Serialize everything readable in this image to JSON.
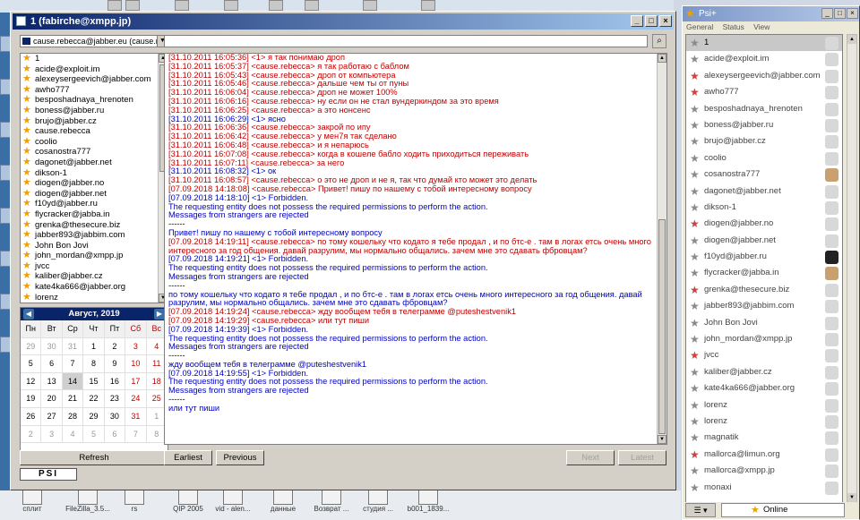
{
  "desktop": {
    "bottom_icons": [
      {
        "label": "сплит",
        "icon": "folder-icon"
      },
      {
        "label": "FileZilla_3.5...",
        "icon": "filezilla-icon"
      },
      {
        "label": "rs",
        "icon": "archive-icon"
      },
      {
        "label": "QIP 2005",
        "icon": "qip-icon"
      },
      {
        "label": "vid - alen...",
        "icon": "document-icon"
      },
      {
        "label": "данные",
        "icon": "document-icon"
      },
      {
        "label": "Возврат ...",
        "icon": "document-icon"
      },
      {
        "label": "студия ...",
        "icon": "document-icon"
      },
      {
        "label": "b001_1839...",
        "icon": "pdf-icon"
      }
    ]
  },
  "chat": {
    "title": "1 (fabirche@xmpp.jp)",
    "account": "cause.rebecca@jabber.eu (cause.reb",
    "contacts": [
      "1",
      "acide@exploit.im",
      "alexeysergeevich@jabber.com",
      "awho777",
      "besposhadnaya_hrenoten",
      "boness@jabber.ru",
      "brujo@jabber.cz",
      "cause.rebecca",
      "coolio",
      "cosanostra777",
      "dagonet@jabber.net",
      "dikson-1",
      "diogen@jabber.no",
      "diogen@jabber.net",
      "f10yd@jabber.ru",
      "flycracker@jabba.in",
      "grenka@thesecure.biz",
      "jabber893@jabbim.com",
      "John Bon Jovi",
      "john_mordan@xmpp.jp",
      "jvcc",
      "kaliber@jabber.cz",
      "kate4ka666@jabber.org",
      "lorenz"
    ],
    "calendar": {
      "month_label": "Август, 2019",
      "weekdays": [
        "Пн",
        "Вт",
        "Ср",
        "Чт",
        "Пт",
        "Сб",
        "Вс"
      ],
      "weeks": [
        [
          "29",
          "30",
          "31",
          "1",
          "2",
          "3",
          "4"
        ],
        [
          "5",
          "6",
          "7",
          "8",
          "9",
          "10",
          "11"
        ],
        [
          "12",
          "13",
          "14",
          "15",
          "16",
          "17",
          "18"
        ],
        [
          "19",
          "20",
          "21",
          "22",
          "23",
          "24",
          "25"
        ],
        [
          "26",
          "27",
          "28",
          "29",
          "30",
          "31",
          "1"
        ],
        [
          "2",
          "3",
          "4",
          "5",
          "6",
          "7",
          "8"
        ]
      ],
      "today": "14"
    },
    "buttons": {
      "refresh": "Refresh",
      "earliest": "Earliest",
      "previous": "Previous",
      "next": "Next",
      "latest": "Latest"
    },
    "logo": "PSI",
    "log": [
      {
        "c": "rd",
        "t": "[31.10.2011 16:05:36] <1> я так понимаю дроп"
      },
      {
        "c": "rd",
        "t": "[31.10.2011 16:05:37] <cause.rebecca> я так работаю с баблом"
      },
      {
        "c": "rd",
        "t": "[31.10.2011 16:05:43] <cause.rebecca> дроп от компьютера"
      },
      {
        "c": "rd",
        "t": "[31.10.2011 16:05:46] <cause.rebecca> дальше чем ты от пуны"
      },
      {
        "c": "rd",
        "t": "[31.10.2011 16:06:04] <cause.rebecca> дроп не может 100%"
      },
      {
        "c": "rd",
        "t": "[31.10.2011 16:06:16] <cause.rebecca> ну если он не стал вундеркиндом за это время"
      },
      {
        "c": "rd",
        "t": "[31.10.2011 16:06:25] <cause.rebecca> а это нонсенс"
      },
      {
        "c": "bl",
        "t": "[31.10.2011 16:06:29] <1> ясно"
      },
      {
        "c": "rd",
        "t": "[31.10.2011 16:06:36] <cause.rebecca> закрой по ипу"
      },
      {
        "c": "rd",
        "t": "[31.10.2011 16:06:42] <cause.rebecca> у мен7я так сделано"
      },
      {
        "c": "rd",
        "t": "[31.10.2011 16:06:48] <cause.rebecca> и я непарюсь"
      },
      {
        "c": "rd",
        "t": "[31.10.2011 16:07:08] <cause.rebecca> когда в кошеле бабло ходить приходиться переживать"
      },
      {
        "c": "rd",
        "t": "[31.10.2011 16:07:11] <cause.rebecca> за него"
      },
      {
        "c": "bl",
        "t": "[31.10.2011 16:08:32] <1> ок"
      },
      {
        "c": "rd",
        "t": "[31.10.2011 16:08:57] <cause.rebecca> о это не дроп и не я, так что думай кто может это делать"
      },
      {
        "c": "rd",
        "t": "[07.09.2018 14:18:08] <cause.rebecca> Привет! пишу по нашему с тобой интересному вопросу"
      },
      {
        "c": "bl",
        "t": "[07.09.2018 14:18:10] <1> Forbidden."
      },
      {
        "c": "bl",
        "t": "The requesting entity does not possess the required permissions to perform the action."
      },
      {
        "c": "bl",
        "t": "Messages from strangers are rejected"
      },
      {
        "c": "bk",
        "t": "------"
      },
      {
        "c": "bl",
        "t": "Привет! пишу по нашему с тобой интересному вопросу"
      },
      {
        "c": "rd",
        "t": "[07.09.2018 14:19:11] <cause.rebecca> по тому кошельку что кодато я тебе продал , и по бтс-е . там в логах етсь очень много интересного за год общения. давай разрулим, мы нормально общались. зачем мне это сдавать фбровцам?",
        "w": true
      },
      {
        "c": "bl",
        "t": "[07.09.2018 14:19:21] <1> Forbidden."
      },
      {
        "c": "bl",
        "t": "The requesting entity does not possess the required permissions to perform the action."
      },
      {
        "c": "bl",
        "t": "Messages from strangers are rejected"
      },
      {
        "c": "bk",
        "t": "------"
      },
      {
        "c": "bl",
        "t": "по тому кошельку что кодато я тебе продал , и по бтс-е . там в логах етсь очень много интересного за год общения. давай разрулим, мы нормально общались. зачем мне это сдавать фбровцам?",
        "w": true
      },
      {
        "c": "rd",
        "t": "[07.09.2018 14:19:24] <cause.rebecca> жду вообщем тебя в телеграмме @puteshestvenik1"
      },
      {
        "c": "rd",
        "t": "[07.09.2018 14:19:29] <cause.rebecca> или тут пиши"
      },
      {
        "c": "bl",
        "t": "[07.09.2018 14:19:39] <1> Forbidden."
      },
      {
        "c": "bl",
        "t": "The requesting entity does not possess the required permissions to perform the action."
      },
      {
        "c": "bl",
        "t": "Messages from strangers are rejected"
      },
      {
        "c": "bk",
        "t": "------"
      },
      {
        "c": "bl",
        "t": "жду вообщем тебя в телеграмме @puteshestvenik1"
      },
      {
        "c": "bl",
        "t": "[07.09.2018 14:19:55] <1> Forbidden."
      },
      {
        "c": "bl",
        "t": "The requesting entity does not possess the required permissions to perform the action."
      },
      {
        "c": "bl",
        "t": "Messages from strangers are rejected"
      },
      {
        "c": "bk",
        "t": "------"
      },
      {
        "c": "bl",
        "t": "или тут пиши"
      }
    ]
  },
  "roster": {
    "title": "Psi+",
    "menu": [
      "General",
      "Status",
      "View"
    ],
    "contacts": [
      {
        "name": "1",
        "st": "gray",
        "av": "",
        "sel": true
      },
      {
        "name": "acide@exploit.im",
        "st": "gray",
        "av": ""
      },
      {
        "name": "alexeysergeevich@jabber.com",
        "st": "red",
        "av": ""
      },
      {
        "name": "awho777",
        "st": "red",
        "av": ""
      },
      {
        "name": "besposhadnaya_hrenoten",
        "st": "gray",
        "av": ""
      },
      {
        "name": "boness@jabber.ru",
        "st": "gray",
        "av": ""
      },
      {
        "name": "brujo@jabber.cz",
        "st": "gray",
        "av": ""
      },
      {
        "name": "coolio",
        "st": "gray",
        "av": ""
      },
      {
        "name": "cosanostra777",
        "st": "gray",
        "av": "tn"
      },
      {
        "name": "dagonet@jabber.net",
        "st": "gray",
        "av": ""
      },
      {
        "name": "dikson-1",
        "st": "gray",
        "av": ""
      },
      {
        "name": "diogen@jabber.no",
        "st": "red",
        "av": ""
      },
      {
        "name": "diogen@jabber.net",
        "st": "gray",
        "av": ""
      },
      {
        "name": "f10yd@jabber.ru",
        "st": "gray",
        "av": "dk"
      },
      {
        "name": "flycracker@jabba.in",
        "st": "gray",
        "av": "tn"
      },
      {
        "name": "grenka@thesecure.biz",
        "st": "red",
        "av": ""
      },
      {
        "name": "jabber893@jabbim.com",
        "st": "gray",
        "av": ""
      },
      {
        "name": "John Bon Jovi",
        "st": "gray",
        "av": ""
      },
      {
        "name": "john_mordan@xmpp.jp",
        "st": "gray",
        "av": ""
      },
      {
        "name": "jvcc",
        "st": "red",
        "av": ""
      },
      {
        "name": "kaliber@jabber.cz",
        "st": "gray",
        "av": ""
      },
      {
        "name": "kate4ka666@jabber.org",
        "st": "gray",
        "av": ""
      },
      {
        "name": "lorenz",
        "st": "gray",
        "av": ""
      },
      {
        "name": "lorenz",
        "st": "gray",
        "av": ""
      },
      {
        "name": "magnatik",
        "st": "gray",
        "av": ""
      },
      {
        "name": "mallorca@limun.org",
        "st": "red",
        "av": ""
      },
      {
        "name": "mallorca@xmpp.jp",
        "st": "gray",
        "av": ""
      },
      {
        "name": "monaxi",
        "st": "gray",
        "av": ""
      }
    ],
    "status": "Online"
  }
}
